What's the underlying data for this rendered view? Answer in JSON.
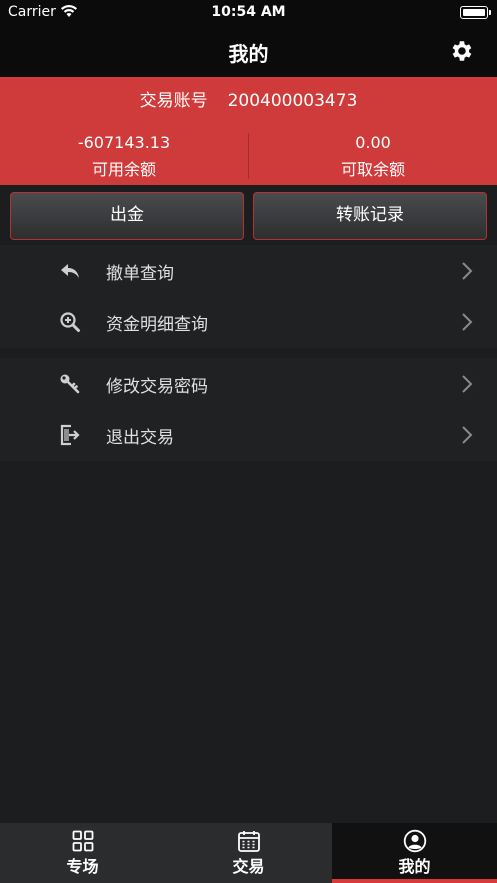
{
  "status": {
    "carrier": "Carrier",
    "time": "10:54 AM"
  },
  "nav": {
    "title": "我的",
    "settings_icon": "gear-icon"
  },
  "account": {
    "label": "交易账号",
    "number": "200400003473",
    "available_value": "-607143.13",
    "available_label": "可用余额",
    "withdrawable_value": "0.00",
    "withdrawable_label": "可取余额",
    "panel_color": "#cf3a3a"
  },
  "actions": {
    "withdraw": "出金",
    "transfer_records": "转账记录"
  },
  "menu": [
    {
      "label": "撤单查询",
      "icon": "undo-icon"
    },
    {
      "label": "资金明细查询",
      "icon": "zoom-in-icon"
    },
    {
      "label": "修改交易密码",
      "icon": "key-icon"
    },
    {
      "label": "退出交易",
      "icon": "logout-icon"
    }
  ],
  "tabs": [
    {
      "label": "专场",
      "icon": "grid-icon"
    },
    {
      "label": "交易",
      "icon": "calendar-icon"
    },
    {
      "label": "我的",
      "icon": "user-circle-icon",
      "active": true
    }
  ],
  "accent_color": "#d83a3a"
}
